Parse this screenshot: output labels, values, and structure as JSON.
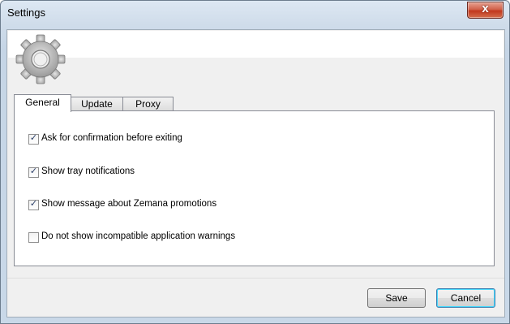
{
  "window": {
    "title": "Settings",
    "close_glyph": "x",
    "close_icon": "close-icon",
    "header_icon": "gear-icon"
  },
  "tabs": [
    {
      "label": "General",
      "active": true
    },
    {
      "label": "Update",
      "active": false
    },
    {
      "label": "Proxy",
      "active": false
    }
  ],
  "general": {
    "options": [
      {
        "label": "Ask for confirmation before exiting",
        "checked": true
      },
      {
        "label": "Show tray notifications",
        "checked": true
      },
      {
        "label": "Show message about Zemana promotions",
        "checked": true
      },
      {
        "label": "Do not show incompatible application warnings",
        "checked": false
      }
    ]
  },
  "buttons": {
    "save_label": "Save",
    "cancel_label": "Cancel"
  },
  "colors": {
    "close_button": "#c2371d",
    "default_button_border": "#3c7fb1"
  }
}
